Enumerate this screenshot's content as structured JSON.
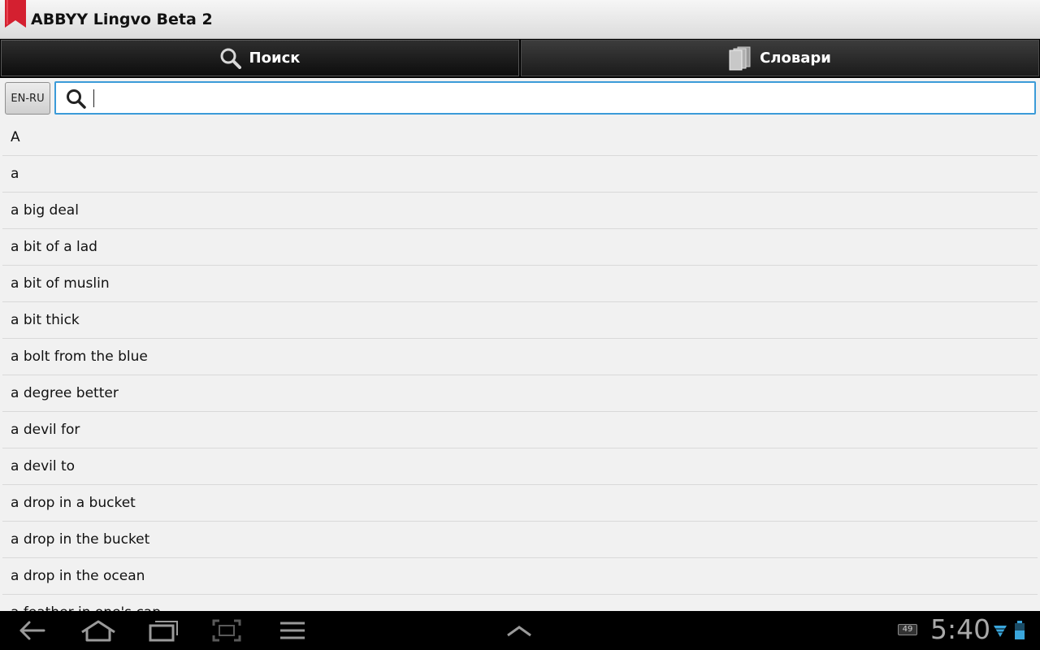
{
  "app": {
    "title": "ABBYY Lingvo Beta 2"
  },
  "tabs": [
    {
      "label": "Поиск",
      "icon": "search-icon",
      "active": true
    },
    {
      "label": "Словари",
      "icon": "dictionaries-icon",
      "active": false
    }
  ],
  "search": {
    "language_pair": "EN-RU",
    "value": "",
    "placeholder": ""
  },
  "words": [
    "A",
    "a",
    "a big deal",
    "a bit of a lad",
    "a bit of muslin",
    "a bit thick",
    "a bolt from the blue",
    "a degree better",
    "a devil for",
    "a devil to",
    "a drop in a bucket",
    "a drop in the bucket",
    "a drop in the ocean",
    "a feather in one's cap"
  ],
  "system_bar": {
    "clock": "5:40",
    "notification_count": "49",
    "icons": [
      "back-icon",
      "home-icon",
      "recent-apps-icon",
      "screenshot-icon",
      "menu-icon",
      "chevron-up-icon",
      "wifi-icon",
      "battery-icon"
    ]
  },
  "colors": {
    "accent": "#3b9bd8",
    "bookmark": "#d42030",
    "tab_bg": "#1b1b1b"
  }
}
